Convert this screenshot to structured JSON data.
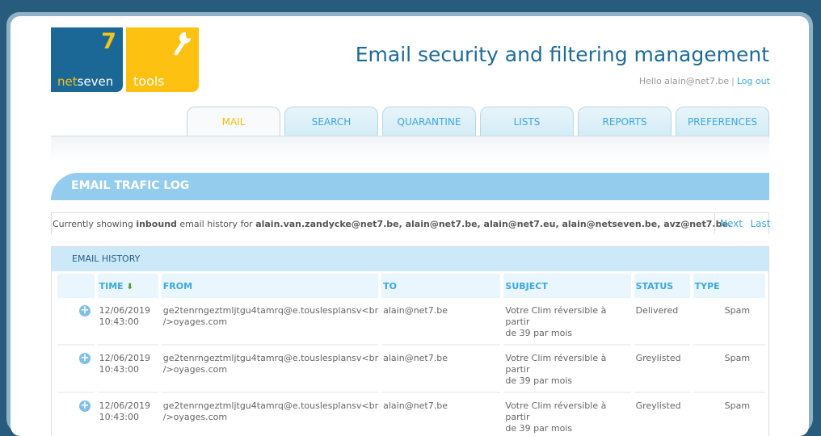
{
  "logo": {
    "seven": "7",
    "net": "net",
    "seven_word": "seven",
    "tools": "tools"
  },
  "header": {
    "title": "Email security and filtering management",
    "hello": "Hello alain@net7.be",
    "separator": "|",
    "logout": "Log out"
  },
  "tabs": [
    {
      "label": "MAIL",
      "active": true
    },
    {
      "label": "SEARCH"
    },
    {
      "label": "QUARANTINE"
    },
    {
      "label": "LISTS"
    },
    {
      "label": "REPORTS"
    },
    {
      "label": "PREFERENCES"
    }
  ],
  "section": {
    "title": "EMAIL TRAFIC LOG"
  },
  "info": {
    "prefix": "Currently showing ",
    "direction": "inbound",
    "middle": " email history for ",
    "addresses": "alain.van.zandycke@net7.be, alain@net7.be, alain@net7.eu, alain@netseven.be, avz@net7.be.",
    "next": "Next",
    "last": "Last"
  },
  "history": {
    "title": "EMAIL HISTORY",
    "columns": {
      "time": "TIME",
      "from": "FROM",
      "to": "TO",
      "subject": "SUBJECT",
      "status": "STATUS",
      "type": "TYPE"
    },
    "sort_icon": "⬇",
    "rows": [
      {
        "date": "12/06/2019",
        "time": "10:43:00",
        "from1": "ge2tenrngeztmljtgu4tamrq@e.touslesplansv<br",
        "from2": "/>oyages.com",
        "to": "alain@net7.be",
        "subject1": "Votre Clim réversible à partir",
        "subject2": "de 39  par mois",
        "status": "Delivered",
        "type": "Spam"
      },
      {
        "date": "12/06/2019",
        "time": "10:43:00",
        "from1": "ge2tenrngeztmljtgu4tamrq@e.touslesplansv<br",
        "from2": "/>oyages.com",
        "to": "alain@net7.be",
        "subject1": "Votre Clim réversible à partir",
        "subject2": "de 39  par mois",
        "status": "Greylisted",
        "type": "Spam"
      },
      {
        "date": "12/06/2019",
        "time": "10:43:00",
        "from1": "ge2tenrngeztmljtgu4tamrq@e.touslesplansv<br",
        "from2": "/>oyages.com",
        "to": "alain@net7.be",
        "subject1": "Votre Clim réversible à partir",
        "subject2": "de 39  par mois",
        "status": "Greylisted",
        "type": "Spam"
      }
    ]
  }
}
